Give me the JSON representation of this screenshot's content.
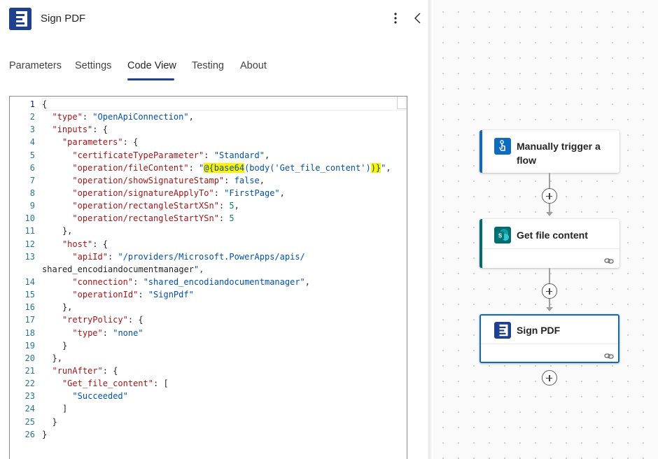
{
  "panel": {
    "title": "Sign PDF",
    "more_icon": "more-vertical-icon",
    "collapse_icon": "chevron-left-icon"
  },
  "tabs": [
    {
      "label": "Parameters"
    },
    {
      "label": "Settings"
    },
    {
      "label": "Code View",
      "active": true
    },
    {
      "label": "Testing"
    },
    {
      "label": "About"
    }
  ],
  "code_lines": [
    {
      "n": "1",
      "t": "{"
    },
    {
      "n": "2",
      "t": "  \"type\": \"OpenApiConnection\","
    },
    {
      "n": "3",
      "t": "  \"inputs\": {"
    },
    {
      "n": "4",
      "t": "    \"parameters\": {"
    },
    {
      "n": "5",
      "t": "      \"certificateTypeParameter\": \"Standard\","
    },
    {
      "n": "6",
      "t": "      \"operation/fileContent\": \"@{base64(body('Get_file_content'))}\","
    },
    {
      "n": "7",
      "t": "      \"operation/showSignatureStamp\": false,"
    },
    {
      "n": "8",
      "t": "      \"operation/signatureApplyTo\": \"FirstPage\","
    },
    {
      "n": "9",
      "t": "      \"operation/rectangleStartXSn\": 5,"
    },
    {
      "n": "10",
      "t": "      \"operation/rectangleStartYSn\": 5"
    },
    {
      "n": "11",
      "t": "    },"
    },
    {
      "n": "12",
      "t": "    \"host\": {"
    },
    {
      "n": "13",
      "t": "      \"apiId\": \"/providers/Microsoft.PowerApps/apis/"
    },
    {
      "n": "",
      "t": "shared_encodiandocumentmanager\","
    },
    {
      "n": "14",
      "t": "      \"connection\": \"shared_encodiandocumentmanager\","
    },
    {
      "n": "15",
      "t": "      \"operationId\": \"SignPdf\""
    },
    {
      "n": "16",
      "t": "    },"
    },
    {
      "n": "17",
      "t": "    \"retryPolicy\": {"
    },
    {
      "n": "18",
      "t": "      \"type\": \"none\""
    },
    {
      "n": "19",
      "t": "    }"
    },
    {
      "n": "20",
      "t": "  },"
    },
    {
      "n": "21",
      "t": "  \"runAfter\": {"
    },
    {
      "n": "22",
      "t": "    \"Get_file_content\": ["
    },
    {
      "n": "23",
      "t": "      \"Succeeded\""
    },
    {
      "n": "24",
      "t": "    ]"
    },
    {
      "n": "25",
      "t": "  }"
    },
    {
      "n": "26",
      "t": "}"
    }
  ],
  "flow": {
    "trigger": {
      "title": "Manually trigger a flow",
      "title_line1": "Manually trigger a",
      "title_line2": "flow",
      "icon": "touch-trigger-icon",
      "accent": "#0f6cbd"
    },
    "get_file": {
      "title": "Get file content",
      "icon": "sharepoint-icon",
      "accent": "#036c70",
      "link_icon": "link-icon"
    },
    "sign_pdf": {
      "title": "Sign PDF",
      "icon": "encodian-logo-icon",
      "accent": "#0f6cbd",
      "link_icon": "link-icon",
      "selected": true
    },
    "add_icon": "plus-circle-icon"
  },
  "colors": {
    "brand": "#1f3f8f",
    "highlight": "#fff200",
    "key": "#a31515",
    "string": "#0451a5",
    "number": "#098658"
  }
}
